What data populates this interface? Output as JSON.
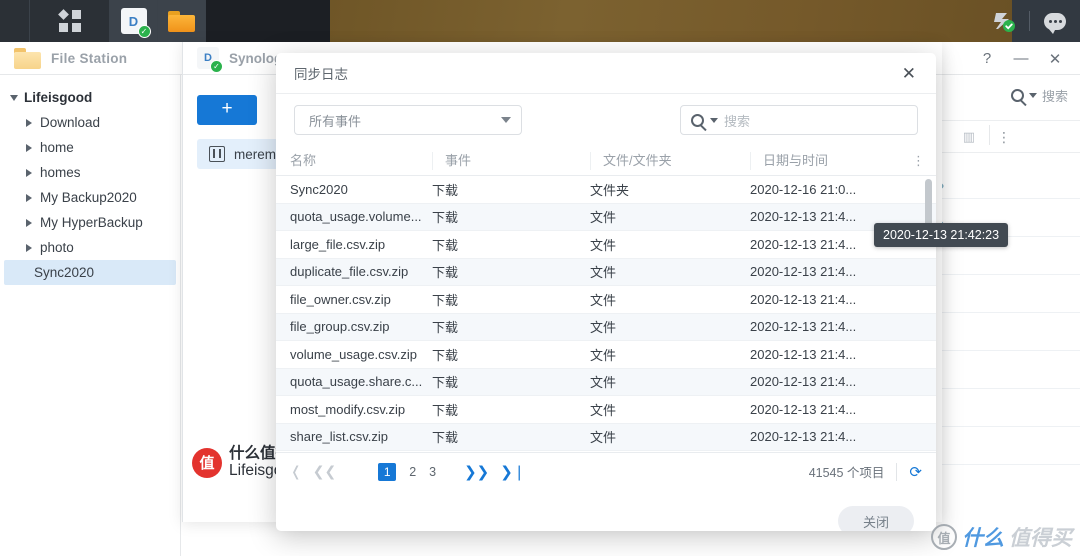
{
  "taskbar": {
    "menu_icon": "apps-grid-icon",
    "items": [
      {
        "name": "synology-drive-taskbar-icon",
        "glyph": "D"
      },
      {
        "name": "file-station-taskbar-icon",
        "glyph": "folder"
      }
    ],
    "right_items": [
      {
        "name": "ds-notification-icon",
        "glyph": "ds"
      },
      {
        "name": "chat-icon",
        "glyph": "chat"
      }
    ]
  },
  "file_station": {
    "title": "File Station",
    "tree": {
      "root_label": "Lifeisgood",
      "items": [
        {
          "label": "Download",
          "selected": false
        },
        {
          "label": "home",
          "selected": false
        },
        {
          "label": "homes",
          "selected": false
        },
        {
          "label": "My Backup2020",
          "selected": false
        },
        {
          "label": "My HyperBackup",
          "selected": false
        },
        {
          "label": "photo",
          "selected": false
        },
        {
          "label": "Sync2020",
          "selected": true
        }
      ]
    },
    "search_placeholder": "搜索",
    "window_controls": {
      "help": "?",
      "minimize": "—",
      "close": "✕"
    }
  },
  "synology_drive": {
    "title": "Synology Drive",
    "add_button_label": "+",
    "connection_item_label": "merem"
  },
  "modal": {
    "title": "同步日志",
    "close_icon_label": "✕",
    "filter_select_value": "所有事件",
    "search_placeholder": "搜索",
    "columns": [
      "名称",
      "事件",
      "文件/文件夹",
      "日期与时间"
    ],
    "rows": [
      {
        "name": "Sync2020",
        "event": "下载",
        "type": "文件夹",
        "datetime": "2020-12-16 21:0..."
      },
      {
        "name": "quota_usage.volume...",
        "event": "下载",
        "type": "文件",
        "datetime": "2020-12-13 21:4..."
      },
      {
        "name": "large_file.csv.zip",
        "event": "下载",
        "type": "文件",
        "datetime": "2020-12-13 21:4..."
      },
      {
        "name": "duplicate_file.csv.zip",
        "event": "下载",
        "type": "文件",
        "datetime": "2020-12-13 21:4..."
      },
      {
        "name": "file_owner.csv.zip",
        "event": "下载",
        "type": "文件",
        "datetime": "2020-12-13 21:4..."
      },
      {
        "name": "file_group.csv.zip",
        "event": "下载",
        "type": "文件",
        "datetime": "2020-12-13 21:4..."
      },
      {
        "name": "volume_usage.csv.zip",
        "event": "下载",
        "type": "文件",
        "datetime": "2020-12-13 21:4..."
      },
      {
        "name": "quota_usage.share.c...",
        "event": "下载",
        "type": "文件",
        "datetime": "2020-12-13 21:4..."
      },
      {
        "name": "most_modify.csv.zip",
        "event": "下载",
        "type": "文件",
        "datetime": "2020-12-13 21:4..."
      },
      {
        "name": "share_list.csv.zip",
        "event": "下载",
        "type": "文件",
        "datetime": "2020-12-13 21:4..."
      }
    ],
    "pagination": {
      "first_label": "❬",
      "prev_label": "❮❮",
      "pages": [
        "1",
        "2",
        "3"
      ],
      "current_page": "1",
      "next_label": "❯❯",
      "last_label": "❯❘",
      "item_count_text": "41545 个项目",
      "refresh_icon": "refresh-icon"
    },
    "footer_button_label": "关闭"
  },
  "tooltip": {
    "text": "2020-12-13 21:42:23"
  },
  "watermark": {
    "badge": "值",
    "line1": "什么值得买",
    "line2": "Lifeisgood",
    "corner_badge": "值",
    "corner_text_1": "什么",
    "corner_text_2": "值得买"
  },
  "colors": {
    "accent": "#1678d6",
    "taskbar": "#1c1f24",
    "selection": "#d9e9f8",
    "tooltip_bg": "#424a52",
    "badge_red": "#e3332e"
  }
}
